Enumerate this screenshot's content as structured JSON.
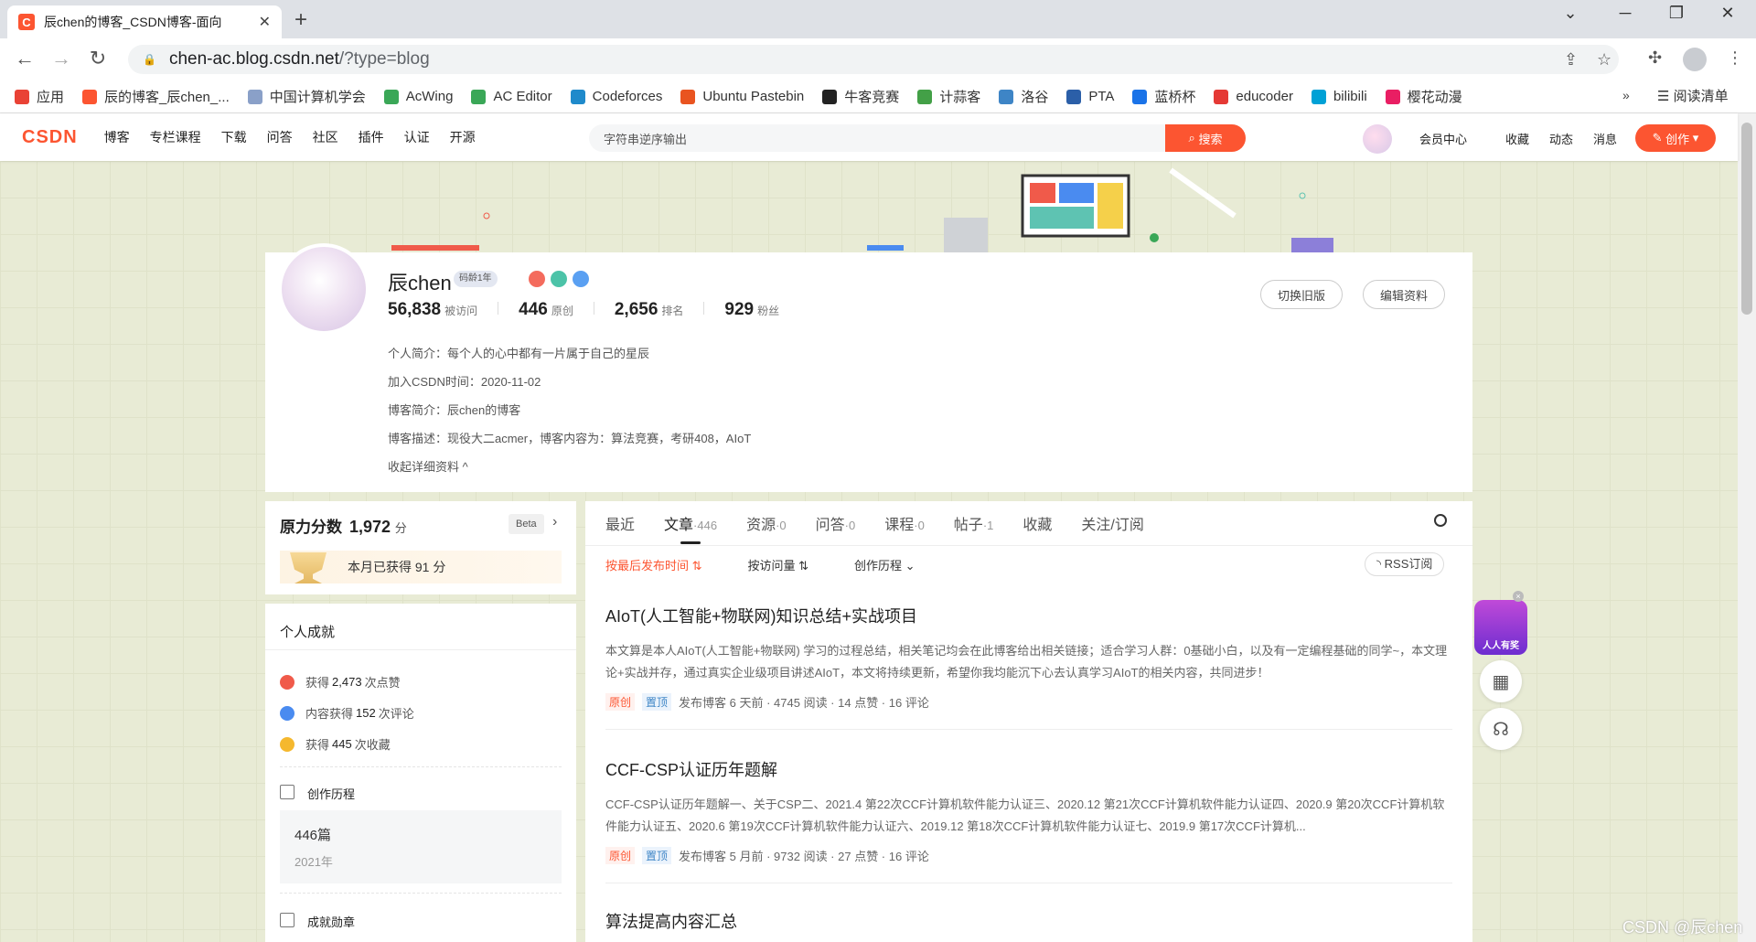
{
  "browser": {
    "tab_title": "辰chen的博客_CSDN博客-面向",
    "tab_favicon": "C",
    "url_host": "chen-ac.blog.csdn.net",
    "url_path": "/?type=blog",
    "bookmarks": [
      {
        "label": "应用",
        "color": "#e94235"
      },
      {
        "label": "辰的博客_辰chen_...",
        "color": "#fc5531"
      },
      {
        "label": "中国计算机学会",
        "color": "#8aa0c8"
      },
      {
        "label": "AcWing",
        "color": "#3aa757"
      },
      {
        "label": "AC Editor",
        "color": "#3aa757"
      },
      {
        "label": "Codeforces",
        "color": "#1f8acb"
      },
      {
        "label": "Ubuntu Pastebin",
        "color": "#e95420"
      },
      {
        "label": "牛客竞赛",
        "color": "#222222"
      },
      {
        "label": "计蒜客",
        "color": "#43a047"
      },
      {
        "label": "洛谷",
        "color": "#3e85c6"
      },
      {
        "label": "PTA",
        "color": "#2b5fa8"
      },
      {
        "label": "蓝桥杯",
        "color": "#1a73e8"
      },
      {
        "label": "educoder",
        "color": "#e53935"
      },
      {
        "label": "bilibili",
        "color": "#00a1d6"
      },
      {
        "label": "樱花动漫",
        "color": "#e91e63"
      }
    ],
    "bookmarks_more": "»",
    "reading_list": "阅读清单"
  },
  "csdn_header": {
    "logo": "CSDN",
    "nav": [
      "博客",
      "专栏课程",
      "下载",
      "问答",
      "社区",
      "插件",
      "认证",
      "开源"
    ],
    "search_value": "字符串逆序输出",
    "search_button": "搜索",
    "links": [
      "会员中心",
      "收藏",
      "动态",
      "消息"
    ],
    "create_button": "创作"
  },
  "profile": {
    "name": "辰chen",
    "code_age": "码龄1年",
    "stats": [
      {
        "num": "56,838",
        "label": "被访问"
      },
      {
        "num": "446",
        "label": "原创"
      },
      {
        "num": "2,656",
        "label": "排名"
      },
      {
        "num": "929",
        "label": "粉丝"
      }
    ],
    "intro": "个人简介：每个人的心中都有一片属于自己的星辰",
    "joined": "加入CSDN时间：2020-11-02",
    "blog_intro": "博客简介：辰chen的博客",
    "blog_desc": "博客描述：现役大二acmer，博客内容为：算法竞赛，考研408，AIoT",
    "collapse": "收起详细资料",
    "btn_old": "切换旧版",
    "btn_edit": "编辑资料"
  },
  "score": {
    "title": "原力分数",
    "value": "1,972",
    "unit": "分",
    "beta": "Beta",
    "month": "本月已获得 91 分"
  },
  "achievements": {
    "title": "个人成就",
    "items": [
      {
        "pre": "获得",
        "num": "2,473",
        "post": "次点赞",
        "color": "#f05a4a"
      },
      {
        "pre": "内容获得",
        "num": "152",
        "post": "次评论",
        "color": "#4a8bf0"
      },
      {
        "pre": "获得",
        "num": "445",
        "post": "次收藏",
        "color": "#f5b82e"
      }
    ]
  },
  "history": {
    "title": "创作历程",
    "count": "446篇",
    "year": "2021年"
  },
  "medals": {
    "title": "成就勋章"
  },
  "main": {
    "tabs": [
      {
        "label": "最近",
        "count": ""
      },
      {
        "label": "文章",
        "count": "·446"
      },
      {
        "label": "资源",
        "count": "·0"
      },
      {
        "label": "问答",
        "count": "·0"
      },
      {
        "label": "课程",
        "count": "·0"
      },
      {
        "label": "帖子",
        "count": "·1"
      },
      {
        "label": "收藏",
        "count": ""
      },
      {
        "label": "关注/订阅",
        "count": ""
      }
    ],
    "sorts": [
      "按最后发布时间 ⇅",
      "按访问量 ⇅",
      "创作历程 ⌄"
    ],
    "rss": "RSS订阅",
    "articles": [
      {
        "title": "AIoT(人工智能+物联网)知识总结+实战项目",
        "desc": "本文算是本人AIoT(人工智能+物联网) 学习的过程总结，相关笔记均会在此博客给出相关链接；适合学习人群：0基础小白，以及有一定编程基础的同学~，本文理论+实战并存，通过真实企业级项目讲述AIoT，本文将持续更新，希望你我均能沉下心去认真学习AIoT的相关内容，共同进步！",
        "tag1": "原创",
        "tag2": "置顶",
        "meta": "发布博客 6 天前 · 4745 阅读 · 14 点赞 · 16 评论"
      },
      {
        "title": "CCF-CSP认证历年题解",
        "desc": "CCF-CSP认证历年题解一、关于CSP二、2021.4 第22次CCF计算机软件能力认证三、2020.12 第21次CCF计算机软件能力认证四、2020.9 第20次CCF计算机软件能力认证五、2020.6 第19次CCF计算机软件能力认证六、2019.12 第18次CCF计算机软件能力认证七、2019.9 第17次CCF计算机...",
        "tag1": "原创",
        "tag2": "置顶",
        "meta": "发布博客 5 月前 · 9732 阅读 · 27 点赞 · 16 评论"
      },
      {
        "title": "算法提高内容汇总",
        "desc": "",
        "tag1": "",
        "tag2": "",
        "meta": ""
      }
    ]
  },
  "promo": "人人有奖",
  "watermark": "CSDN @辰chen",
  "colors": {
    "accent": "#fc5531",
    "link_blue": "#3e85c6"
  }
}
